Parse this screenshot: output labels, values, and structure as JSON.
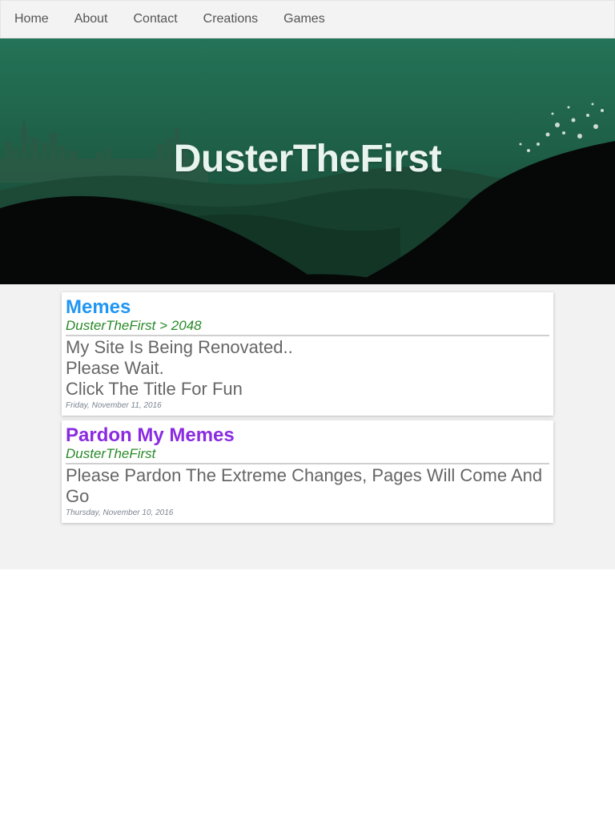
{
  "nav": {
    "items": [
      {
        "label": "Home"
      },
      {
        "label": "About"
      },
      {
        "label": "Contact"
      },
      {
        "label": "Creations"
      },
      {
        "label": "Games"
      }
    ]
  },
  "hero": {
    "title": "DusterTheFirst"
  },
  "posts": [
    {
      "title": "Memes",
      "title_color": "#2196f3",
      "subtitle": "DusterTheFirst > 2048",
      "body": [
        "My Site Is Being Renovated..",
        "Please Wait.",
        "Click The Title For Fun"
      ],
      "date": "Friday, November 11, 2016"
    },
    {
      "title": "Pardon My Memes",
      "title_color": "#8a2be2",
      "subtitle": "DusterTheFirst",
      "body": [
        "Please Pardon The Extreme Changes, Pages Will Come And Go"
      ],
      "date": "Thursday, November 10, 2016"
    }
  ]
}
